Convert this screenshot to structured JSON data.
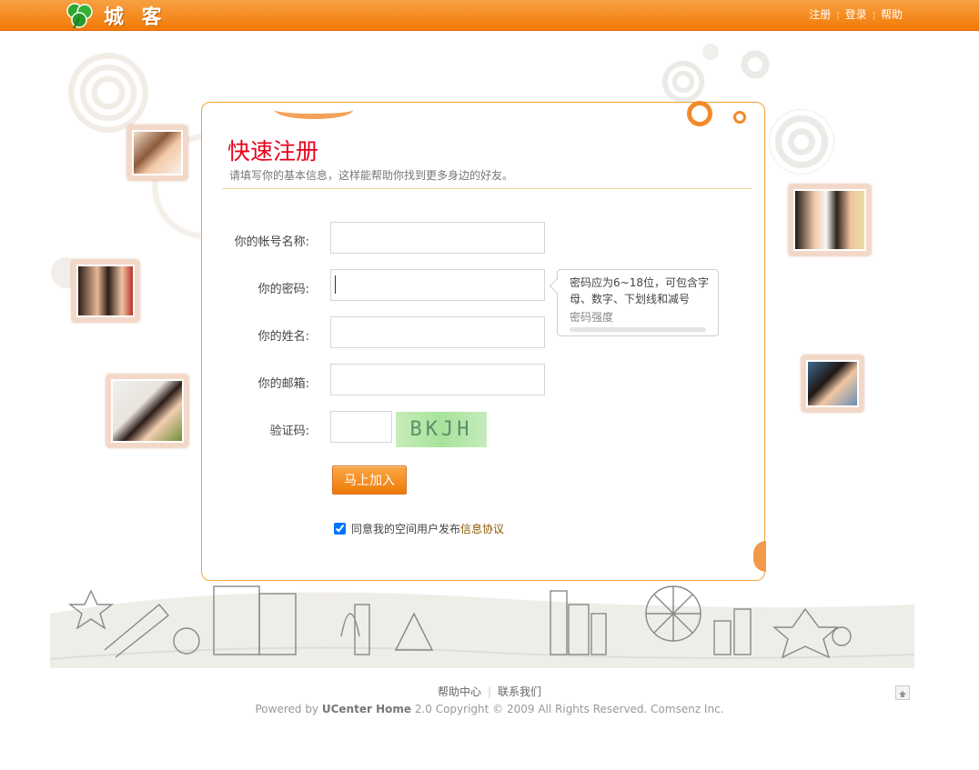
{
  "header": {
    "logo_text": "城 客",
    "links": [
      "注册",
      "登录",
      "帮助"
    ]
  },
  "form": {
    "title": "快速注册",
    "subtitle": "请填写你的基本信息，这样能帮助你找到更多身边的好友。",
    "fields": [
      {
        "label": "你的帐号名称:",
        "value": ""
      },
      {
        "label": "你的密码:",
        "value": ""
      },
      {
        "label": "你的姓名:",
        "value": ""
      },
      {
        "label": "你的邮箱:",
        "value": ""
      },
      {
        "label": "验证码:",
        "value": ""
      }
    ],
    "password_hint": {
      "text_line1": "密码应为6~18位，可包含字",
      "text_line2": "母、数字、下划线和减号",
      "strength_label": "密码强度"
    },
    "captcha_text": "BKJH",
    "submit_label": "马上加入",
    "agree_text": "同意我的空间用户发布",
    "agree_link": "信息协议",
    "agree_checked": true
  },
  "footer": {
    "links": [
      "帮助中心",
      "联系我们"
    ],
    "copyright_prefix": "Powered by ",
    "copyright_brand": "UCenter Home",
    "copyright_suffix": " 2.0 Copyright © 2009 All Rights Reserved. Comsenz Inc."
  },
  "colors": {
    "header": "#f27a06",
    "title": "#e8001c",
    "card_border": "#f0a23a"
  },
  "icons": [
    "clover-logo-icon",
    "back-to-top-icon"
  ]
}
